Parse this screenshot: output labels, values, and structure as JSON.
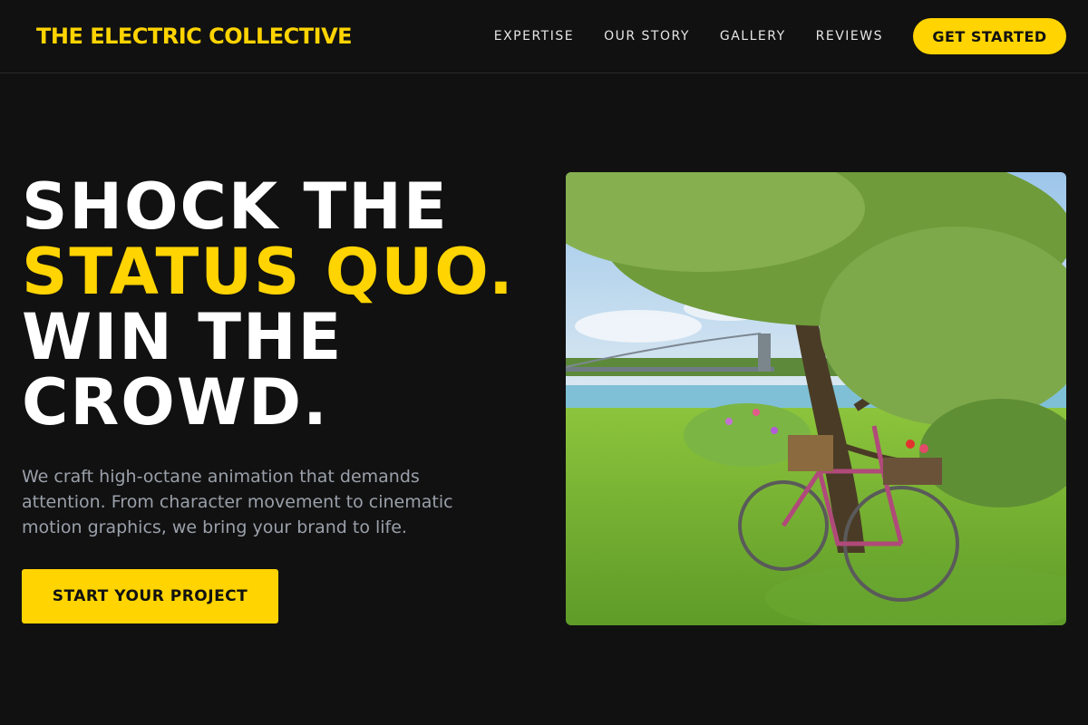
{
  "header": {
    "logo": "THE ELECTRIC COLLECTIVE",
    "nav": [
      {
        "label": "EXPERTISE"
      },
      {
        "label": "OUR STORY"
      },
      {
        "label": "GALLERY"
      },
      {
        "label": "REVIEWS"
      }
    ],
    "cta_label": "GET STARTED"
  },
  "hero": {
    "line1": "SHOCK THE",
    "line2": "STATUS QUO.",
    "line3": "WIN THE",
    "line4": "CROWD.",
    "subtext": "We craft high-octane animation that demands attention. From character movement to cinematic motion graphics, we bring your brand to life.",
    "button_label": "START YOUR PROJECT"
  },
  "colors": {
    "background": "#111111",
    "accent": "#ffd400",
    "muted_text": "#9aa0aa"
  }
}
